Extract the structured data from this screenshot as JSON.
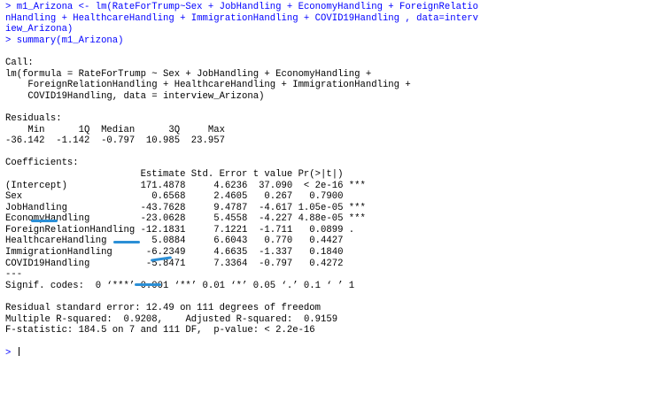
{
  "console": {
    "prompt": "> ",
    "command_1": [
      "m1_Arizona <- lm(RateForTrump~Sex + JobHandling + EconomyHandling + ForeignRelatio",
      "nHandling + HealthcareHandling + ImmigrationHandling + COVID19Handling , data=interv",
      "iew_Arizona)"
    ],
    "command_2": "summary(m1_Arizona)",
    "call": {
      "header": "Call:",
      "lines": [
        "lm(formula = RateForTrump ~ Sex + JobHandling + EconomyHandling + ",
        "    ForeignRelationHandling + HealthcareHandling + ImmigrationHandling + ",
        "    COVID19Handling, data = interview_Arizona)"
      ]
    },
    "residuals": {
      "header": "Residuals:",
      "labels": "    Min      1Q  Median      3Q     Max ",
      "values": "-36.142  -1.142  -0.797  10.985  23.957 "
    },
    "coefficients": {
      "header": "Coefficients:",
      "columns": "                        Estimate Std. Error t value Pr(>|t|)    ",
      "rows": [
        "(Intercept)             171.4878     4.6236  37.090  < 2e-16 ***",
        "Sex                       0.6568     2.4605   0.267   0.7900    ",
        "JobHandling             -43.7628     9.4787  -4.617 1.05e-05 ***",
        "EconomyHandling         -23.0628     5.4558  -4.227 4.88e-05 ***",
        "ForeignRelationHandling -12.1831     7.1221  -1.711   0.0899 .  ",
        "HealthcareHandling        5.0884     6.6043   0.770   0.4427    ",
        "ImmigrationHandling      -6.2349     4.6635  -1.337   0.1840    ",
        "COVID19Handling          -5.8471     7.3364  -0.797   0.4272    "
      ],
      "separator": "---",
      "signif": "Signif. codes:  0 ‘***’ 0.001 ‘**’ 0.01 ‘*’ 0.05 ‘.’ 0.1 ‘ ’ 1"
    },
    "summary_lines": [
      "Residual standard error: 12.49 on 111 degrees of freedom",
      "Multiple R-squared:  0.9208,\tAdjusted R-squared:  0.9159 ",
      "F-statistic: 184.5 on 7 and 111 DF,  p-value: < 2.2e-16"
    ],
    "final_prompt": "> ",
    "colors": {
      "command": "#0000ff",
      "output": "#000000",
      "highlight_marks": "#2b8fd6"
    }
  }
}
